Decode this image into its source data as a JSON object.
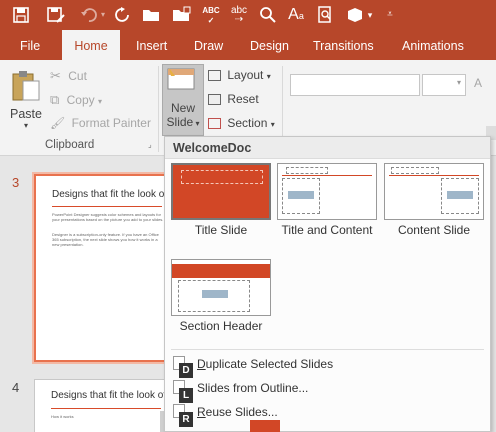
{
  "colors": {
    "accent": "#b7472a",
    "thumb_selected": "#e8724e",
    "ribbon_bg": "#f3f3f3"
  },
  "quick_access": {
    "icons": [
      "save-icon",
      "save-as-icon",
      "undo-icon",
      "redo-icon",
      "open-folder-icon",
      "new-folder-icon",
      "spelling-icon",
      "autocorrect-icon",
      "find-icon",
      "font-size-icon",
      "print-preview-icon",
      "shapes-icon",
      "customize-icon"
    ],
    "spelling_glyph": "ABC",
    "autocorrect_glyph": "abc",
    "font_glyph": "A"
  },
  "tabs": [
    {
      "label": "File"
    },
    {
      "label": "Home"
    },
    {
      "label": "Insert"
    },
    {
      "label": "Draw"
    },
    {
      "label": "Design"
    },
    {
      "label": "Transitions"
    },
    {
      "label": "Animations"
    }
  ],
  "ribbon": {
    "clipboard": {
      "paste": "Paste",
      "cut": "Cut",
      "copy": "Copy",
      "format_painter": "Format Painter",
      "group_label": "Clipboard"
    },
    "slides": {
      "new_slide_line1": "New",
      "new_slide_line2": "Slide",
      "layout": "Layout",
      "reset": "Reset",
      "section": "Section"
    }
  },
  "slide_pane": {
    "slides": [
      {
        "number": "3",
        "title": "Designs that fit the look of y",
        "body1": "PowerPoint Designer suggests color schemes and layouts for your presentations based on the picture you add to your slides.",
        "body2": "Designer is a subscription-only feature. If you have an Office 365 subscription, the next slide shows you how it works in a new presentation."
      },
      {
        "number": "4",
        "title": "Designs that fit the look of",
        "body1": "How it works"
      }
    ]
  },
  "gallery": {
    "header": "WelcomeDoc",
    "layouts": [
      {
        "label": "Title Slide"
      },
      {
        "label": "Title and Content"
      },
      {
        "label": "Content Slide"
      },
      {
        "label": "Section Header"
      }
    ],
    "menu": [
      {
        "label": "Duplicate Selected Slides",
        "keytip": "D",
        "underline": "D"
      },
      {
        "label": "Slides from Outline...",
        "keytip": "L",
        "underline": ""
      },
      {
        "label": "Reuse Slides...",
        "keytip": "R",
        "underline": "R"
      }
    ]
  }
}
